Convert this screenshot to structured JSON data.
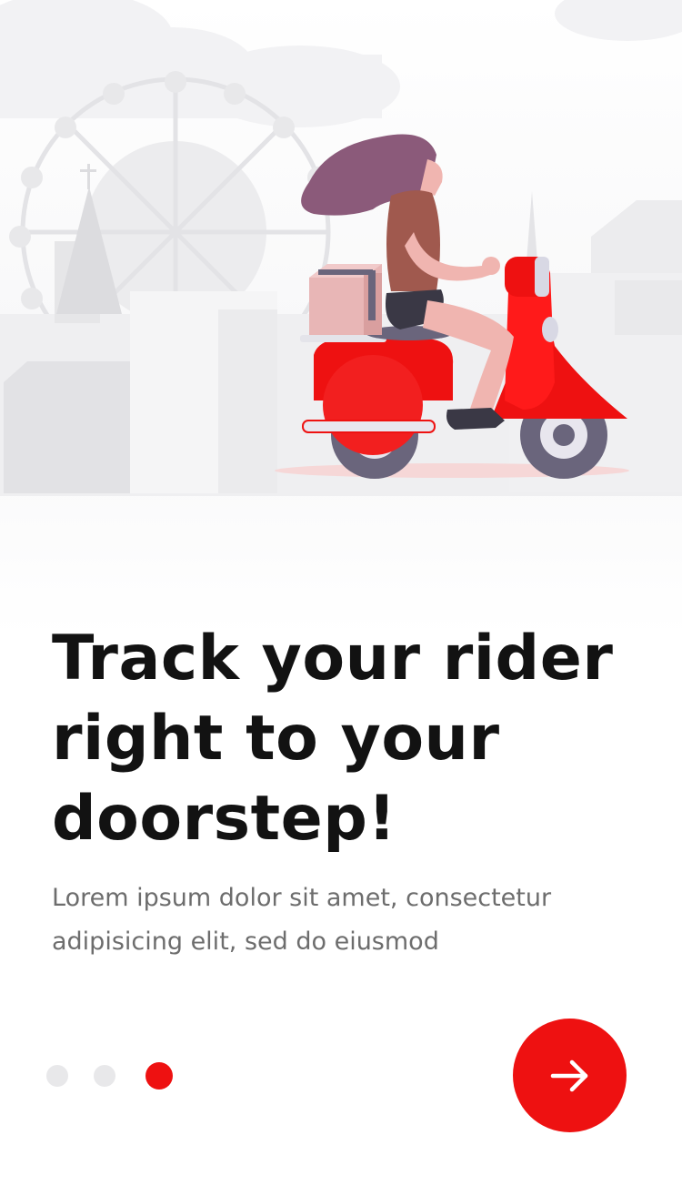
{
  "onboarding": {
    "title": "Track your rider right to your doorstep!",
    "description": "Lorem ipsum dolor sit amet, consectetur adipisicing elit,  sed do eiusmod",
    "pagination": {
      "total": 3,
      "current": 3
    },
    "next_icon": "arrow-right-icon",
    "illustration": "woman-riding-scooter-with-package"
  },
  "colors": {
    "accent": "#ee1111",
    "title": "#121212",
    "description": "#6d6d6d",
    "dot_inactive": "#e8e8ea"
  }
}
